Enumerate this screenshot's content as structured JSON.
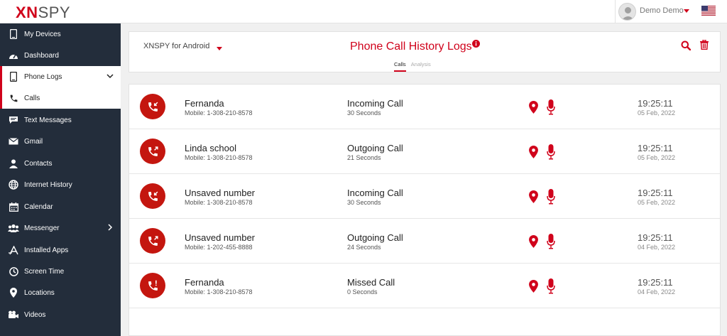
{
  "app": {
    "logo_part1": "XN",
    "logo_part2": "SPY"
  },
  "header": {
    "username": "Demo Demo",
    "flag_icon": "us-flag-icon"
  },
  "colors": {
    "brand": "#d0021b",
    "sidebar_bg": "#232d3b"
  },
  "sidebar": {
    "items": [
      {
        "label": "My Devices",
        "icon": "device-icon"
      },
      {
        "label": "Dashboard",
        "icon": "dashboard-icon"
      },
      {
        "label": "Phone Logs",
        "icon": "phone-icon",
        "expanded": true
      },
      {
        "label": "Calls",
        "icon": "call-icon",
        "active": true
      },
      {
        "label": "Text Messages",
        "icon": "message-icon"
      },
      {
        "label": "Gmail",
        "icon": "mail-icon"
      },
      {
        "label": "Contacts",
        "icon": "contact-icon"
      },
      {
        "label": "Internet History",
        "icon": "globe-icon"
      },
      {
        "label": "Calendar",
        "icon": "calendar-icon"
      },
      {
        "label": "Messenger",
        "icon": "users-icon"
      },
      {
        "label": "Installed Apps",
        "icon": "apps-icon"
      },
      {
        "label": "Screen Time",
        "icon": "clock-icon"
      },
      {
        "label": "Locations",
        "icon": "pin-icon"
      },
      {
        "label": "Videos",
        "icon": "video-icon"
      }
    ]
  },
  "toolbar": {
    "device_selector": "XNSPY for Android",
    "page_title": "Phone Call History Logs",
    "tabs": [
      {
        "label": "Calls",
        "active": true
      },
      {
        "label": "Analysis",
        "active": false
      }
    ]
  },
  "calls": [
    {
      "name": "Fernanda",
      "number": "Mobile: 1-308-210-8578",
      "type": "Incoming Call",
      "duration": "30 Seconds",
      "time": "19:25:11",
      "date": "05 Feb, 2022"
    },
    {
      "name": "Linda school",
      "number": "Mobile: 1-308-210-8578",
      "type": "Outgoing Call",
      "duration": "21 Seconds",
      "time": "19:25:11",
      "date": "05 Feb, 2022"
    },
    {
      "name": "Unsaved number",
      "number": "Mobile: 1-308-210-8578",
      "type": "Incoming Call",
      "duration": "30 Seconds",
      "time": "19:25:11",
      "date": "05 Feb, 2022"
    },
    {
      "name": "Unsaved number",
      "number": "Mobile: 1-202-455-8888",
      "type": "Outgoing Call",
      "duration": "24 Seconds",
      "time": "19:25:11",
      "date": "04 Feb, 2022"
    },
    {
      "name": "Fernanda",
      "number": "Mobile: 1-308-210-8578",
      "type": "Missed Call",
      "duration": "0 Seconds",
      "time": "19:25:11",
      "date": "04 Feb, 2022"
    }
  ]
}
